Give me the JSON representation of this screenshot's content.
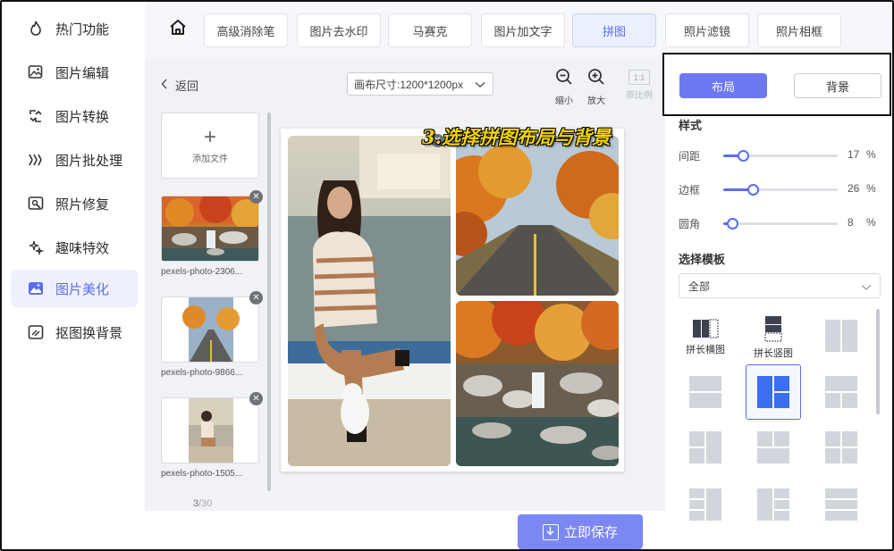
{
  "sidebar": {
    "items": [
      {
        "label": "热门功能",
        "icon": "flame-icon"
      },
      {
        "label": "图片编辑",
        "icon": "image-edit-icon"
      },
      {
        "label": "图片转换",
        "icon": "convert-icon"
      },
      {
        "label": "图片批处理",
        "icon": "batch-icon"
      },
      {
        "label": "照片修复",
        "icon": "photo-repair-icon"
      },
      {
        "label": "趣味特效",
        "icon": "sparkle-icon"
      },
      {
        "label": "图片美化",
        "icon": "beautify-icon"
      },
      {
        "label": "抠图换背景",
        "icon": "cutout-icon"
      }
    ],
    "active_index": 6
  },
  "topbar": {
    "tabs": [
      "高级消除笔",
      "图片去水印",
      "马赛克",
      "图片加文字",
      "拼图",
      "照片滤镜",
      "照片相框"
    ],
    "active_tab": "拼图"
  },
  "toolbar": {
    "back_label": "返回",
    "canvas_size_label": "画布尺寸:1200*1200px",
    "zoom_out_label": "缩小",
    "zoom_in_label": "放大",
    "ratio_box": "1:1",
    "ratio_label": "原比例"
  },
  "files": {
    "add_label": "添加文件",
    "items": [
      {
        "name": "pexels-photo-2306..."
      },
      {
        "name": "pexels-photo-9866..."
      },
      {
        "name": "pexels-photo-1505..."
      }
    ],
    "count_current": "3",
    "count_total": "/30"
  },
  "hint_text": "3.选择拼图布局与背景",
  "save_label": "立即保存",
  "right_panel": {
    "mode_layout": "布局",
    "mode_background": "背景",
    "style_title": "样式",
    "sliders": [
      {
        "label": "间距",
        "value": 17,
        "unit": "%"
      },
      {
        "label": "边框",
        "value": 26,
        "unit": "%"
      },
      {
        "label": "圆角",
        "value": 8,
        "unit": "%"
      }
    ],
    "template_title": "选择模板",
    "template_filter": "全部",
    "templates": [
      {
        "label": "拼长横图"
      },
      {
        "label": "拼长竖图"
      }
    ]
  },
  "colors": {
    "accent": "#5b6cf2",
    "save_button": "#7b87f3",
    "hint": "#f2d300"
  }
}
